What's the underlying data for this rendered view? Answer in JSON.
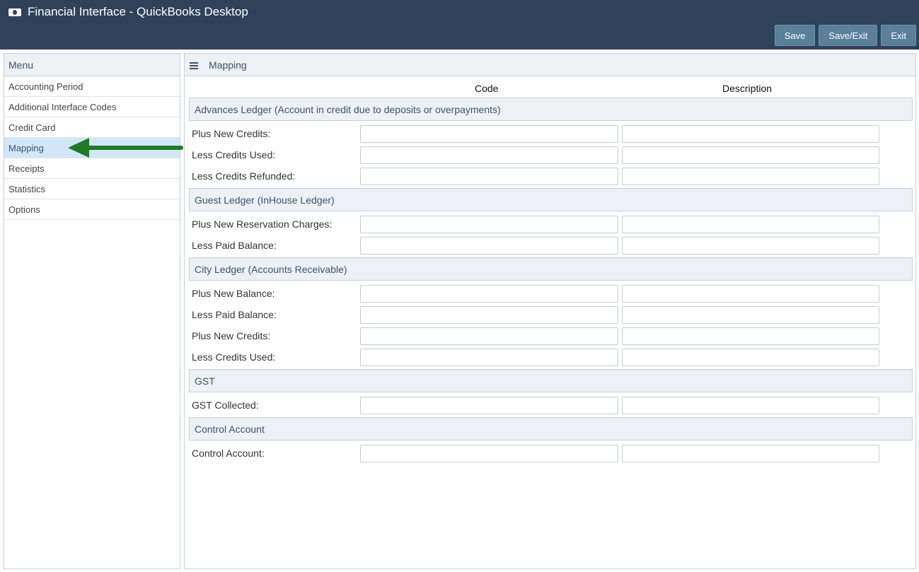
{
  "app": {
    "title": "Financial Interface - QuickBooks Desktop",
    "buttons": {
      "save": "Save",
      "save_exit": "Save/Exit",
      "exit": "Exit"
    }
  },
  "sidebar": {
    "heading": "Menu",
    "items": [
      {
        "label": "Accounting Period"
      },
      {
        "label": "Additional Interface Codes"
      },
      {
        "label": "Credit Card"
      },
      {
        "label": "Mapping",
        "active": true
      },
      {
        "label": "Receipts"
      },
      {
        "label": "Statistics"
      },
      {
        "label": "Options"
      }
    ]
  },
  "main": {
    "heading": "Mapping",
    "columns": {
      "code": "Code",
      "description": "Description"
    },
    "sections": [
      {
        "title": "Advances Ledger (Account in credit due to deposits or overpayments)",
        "rows": [
          {
            "label": "Plus New Credits:",
            "code": "",
            "description": ""
          },
          {
            "label": "Less Credits Used:",
            "code": "",
            "description": ""
          },
          {
            "label": "Less Credits Refunded:",
            "code": "",
            "description": ""
          }
        ]
      },
      {
        "title": "Guest Ledger (InHouse Ledger)",
        "rows": [
          {
            "label": "Plus New Reservation Charges:",
            "code": "",
            "description": ""
          },
          {
            "label": "Less Paid Balance:",
            "code": "",
            "description": ""
          }
        ]
      },
      {
        "title": "City Ledger (Accounts Receivable)",
        "rows": [
          {
            "label": "Plus New Balance:",
            "code": "",
            "description": ""
          },
          {
            "label": "Less Paid Balance:",
            "code": "",
            "description": ""
          },
          {
            "label": "Plus New Credits:",
            "code": "",
            "description": ""
          },
          {
            "label": "Less Credits Used:",
            "code": "",
            "description": ""
          }
        ]
      },
      {
        "title": "GST",
        "rows": [
          {
            "label": "GST Collected:",
            "code": "",
            "description": ""
          }
        ]
      },
      {
        "title": "Control Account",
        "rows": [
          {
            "label": "Control Account:",
            "code": "",
            "description": ""
          }
        ]
      }
    ]
  },
  "colors": {
    "header_bg": "#2e435a",
    "button_bg": "#597f9a",
    "active_item_bg": "#d3e6f7",
    "arrow": "#1e7a2a"
  }
}
